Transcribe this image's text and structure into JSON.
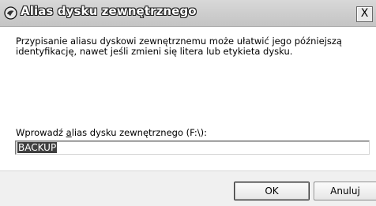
{
  "window": {
    "title": "Alias dysku zewnętrznego",
    "close_glyph": "X",
    "app_icon": "app-logo-icon"
  },
  "description": {
    "line1": "Przypisanie aliasu dyskowi zewnętrznemu może ułatwić jego późniejszą",
    "line2": "identyfikację, nawet jeśli zmieni się litera lub etykieta dysku."
  },
  "input": {
    "label_before": "Wprowadź ",
    "label_accel": "a",
    "label_after": "lias dysku zewnętrznego (F:\\):",
    "value": "BACKUP"
  },
  "buttons": {
    "ok_label": "OK",
    "cancel_label": "Anuluj"
  }
}
